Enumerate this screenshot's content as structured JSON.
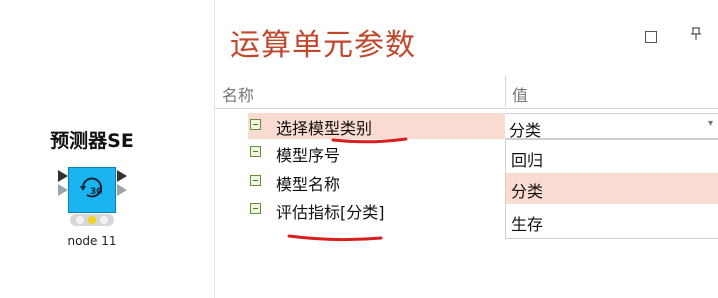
{
  "node": {
    "title": "预测器SE",
    "label": "node 11",
    "icon_text": "30"
  },
  "panel": {
    "title": "运算单元参数",
    "header_name": "名称",
    "header_value": "值"
  },
  "properties": [
    {
      "label": "选择模型类别"
    },
    {
      "label": "模型序号"
    },
    {
      "label": "模型名称"
    },
    {
      "label": "评估指标[分类]"
    }
  ],
  "selected_value": "分类",
  "dropdown_options": [
    "回归",
    "分类",
    "生存"
  ],
  "icons": {
    "maximize": "maximize-icon",
    "pin": "pin-icon",
    "dropdown": "chevron-down-icon"
  },
  "colors": {
    "title": "#c0472c",
    "highlight": "#fadbd2",
    "node": "#1ab4f0",
    "annotation": "#d81e1e"
  }
}
